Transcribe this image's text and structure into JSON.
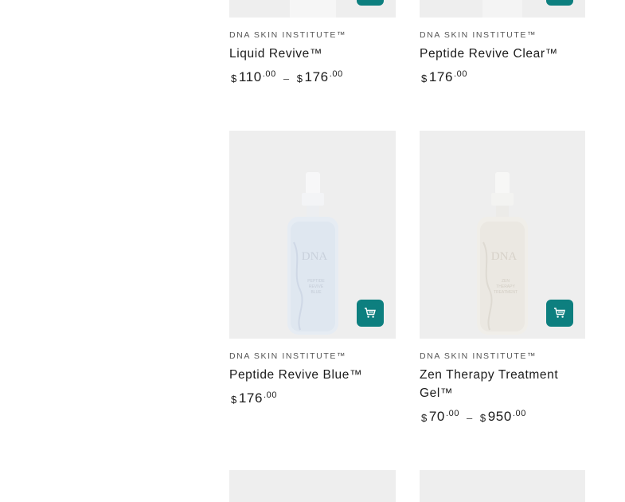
{
  "colors": {
    "accent": "#0d7f7f",
    "image_bg": "#eeeeee"
  },
  "products": [
    {
      "brand": "DNA SKIN INSTITUTE™",
      "title": "Liquid Revive™",
      "price_low": {
        "currency": "$",
        "whole": "110",
        "cents": ".00"
      },
      "separator": "–",
      "price_high": {
        "currency": "$",
        "whole": "176",
        "cents": ".00"
      },
      "cart_icon": "cart-icon"
    },
    {
      "brand": "DNA SKIN INSTITUTE™",
      "title": "Peptide Revive Clear™",
      "price_low": {
        "currency": "$",
        "whole": "176",
        "cents": ".00"
      },
      "cart_icon": "cart-icon"
    },
    {
      "brand": "DNA SKIN INSTITUTE™",
      "title": "Peptide Revive Blue™",
      "price_low": {
        "currency": "$",
        "whole": "176",
        "cents": ".00"
      },
      "image_label": {
        "logo": "DNA",
        "line1": "PEPTIDE",
        "line2": "REVIVE",
        "line3": "BLUE"
      },
      "cart_icon": "cart-icon"
    },
    {
      "brand": "DNA SKIN INSTITUTE™",
      "title_line1": "Zen Therapy Treatment",
      "title_line2": "Gel™",
      "price_low": {
        "currency": "$",
        "whole": "70",
        "cents": ".00"
      },
      "separator": "–",
      "price_high": {
        "currency": "$",
        "whole": "950",
        "cents": ".00"
      },
      "image_label": {
        "logo": "DNA",
        "line1": "ZEN",
        "line2": "THERAPY",
        "line3": "TREATMENT"
      },
      "cart_icon": "cart-icon"
    }
  ]
}
